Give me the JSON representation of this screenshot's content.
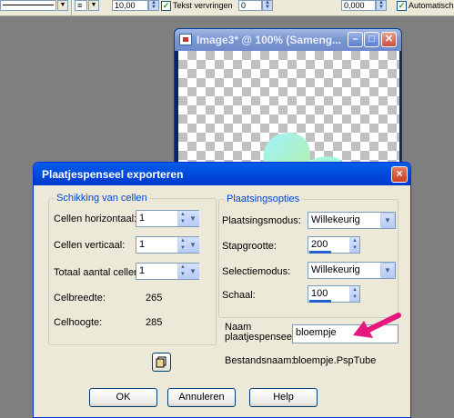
{
  "toolbar": {
    "size_value": "10,00",
    "anti_alias_label": "Tekst vervringen",
    "angle_value": "0",
    "leading_value": "0,000",
    "auto_label": "Automatisch"
  },
  "image_window": {
    "title": "Image3* @ 100% (Sameng..."
  },
  "dialog": {
    "title": "Plaatjespenseel exporteren",
    "close_glyph": "×",
    "cells_group": {
      "title": "Schikking van cellen",
      "horizontal_label": "Cellen horizontaal:",
      "horizontal_value": "1",
      "vertical_label": "Cellen verticaal:",
      "vertical_value": "1",
      "total_label": "Totaal aantal cellen:",
      "total_value": "1",
      "width_label": "Celbreedte:",
      "width_value": "265",
      "height_label": "Celhoogte:",
      "height_value": "285"
    },
    "placement_group": {
      "title": "Plaatsingsopties",
      "mode_label": "Plaatsingsmodus:",
      "mode_value": "Willekeurig",
      "step_label": "Stapgrootte:",
      "step_value": "200",
      "select_label": "Selectiemodus:",
      "select_value": "Willekeurig",
      "scale_label": "Schaal:",
      "scale_value": "100"
    },
    "name_label_line1": "Naam",
    "name_label_line2": "plaatjespenseel:",
    "name_value": "bloempje",
    "filename_label": "Bestandsnaam:",
    "filename_value": "bloempje.PspTube",
    "ok_label": "OK",
    "cancel_label": "Annuleren",
    "help_label": "Help"
  },
  "colors": {
    "arrow": "#e6187e",
    "title_bar": "#0054e3",
    "group_title": "#0046d5"
  }
}
